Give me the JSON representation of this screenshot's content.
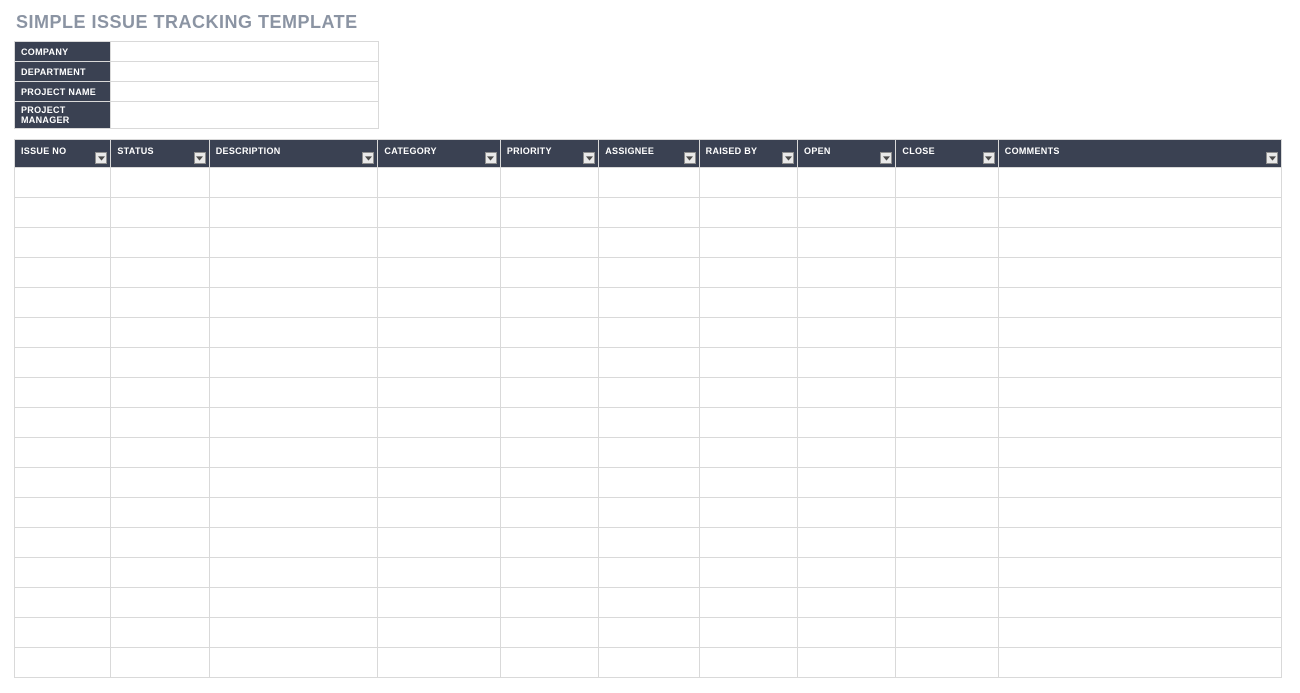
{
  "title": "SIMPLE ISSUE TRACKING TEMPLATE",
  "meta": {
    "fields": [
      {
        "label": "COMPANY",
        "value": ""
      },
      {
        "label": "DEPARTMENT",
        "value": ""
      },
      {
        "label": "PROJECT NAME",
        "value": ""
      },
      {
        "label": "PROJECT MANAGER",
        "value": ""
      }
    ]
  },
  "columns": [
    {
      "label": "ISSUE NO",
      "class": "c-issue"
    },
    {
      "label": "STATUS",
      "class": "c-status"
    },
    {
      "label": "DESCRIPTION",
      "class": "c-desc"
    },
    {
      "label": "CATEGORY",
      "class": "c-category"
    },
    {
      "label": "PRIORITY",
      "class": "c-priority"
    },
    {
      "label": "ASSIGNEE",
      "class": "c-assignee"
    },
    {
      "label": "RAISED BY",
      "class": "c-raised"
    },
    {
      "label": "OPEN",
      "class": "c-open"
    },
    {
      "label": "CLOSE",
      "class": "c-close"
    },
    {
      "label": "COMMENTS",
      "class": "c-comments"
    }
  ],
  "rows": [
    [
      "",
      "",
      "",
      "",
      "",
      "",
      "",
      "",
      "",
      ""
    ],
    [
      "",
      "",
      "",
      "",
      "",
      "",
      "",
      "",
      "",
      ""
    ],
    [
      "",
      "",
      "",
      "",
      "",
      "",
      "",
      "",
      "",
      ""
    ],
    [
      "",
      "",
      "",
      "",
      "",
      "",
      "",
      "",
      "",
      ""
    ],
    [
      "",
      "",
      "",
      "",
      "",
      "",
      "",
      "",
      "",
      ""
    ],
    [
      "",
      "",
      "",
      "",
      "",
      "",
      "",
      "",
      "",
      ""
    ],
    [
      "",
      "",
      "",
      "",
      "",
      "",
      "",
      "",
      "",
      ""
    ],
    [
      "",
      "",
      "",
      "",
      "",
      "",
      "",
      "",
      "",
      ""
    ],
    [
      "",
      "",
      "",
      "",
      "",
      "",
      "",
      "",
      "",
      ""
    ],
    [
      "",
      "",
      "",
      "",
      "",
      "",
      "",
      "",
      "",
      ""
    ],
    [
      "",
      "",
      "",
      "",
      "",
      "",
      "",
      "",
      "",
      ""
    ],
    [
      "",
      "",
      "",
      "",
      "",
      "",
      "",
      "",
      "",
      ""
    ],
    [
      "",
      "",
      "",
      "",
      "",
      "",
      "",
      "",
      "",
      ""
    ],
    [
      "",
      "",
      "",
      "",
      "",
      "",
      "",
      "",
      "",
      ""
    ],
    [
      "",
      "",
      "",
      "",
      "",
      "",
      "",
      "",
      "",
      ""
    ],
    [
      "",
      "",
      "",
      "",
      "",
      "",
      "",
      "",
      "",
      ""
    ],
    [
      "",
      "",
      "",
      "",
      "",
      "",
      "",
      "",
      "",
      ""
    ]
  ]
}
